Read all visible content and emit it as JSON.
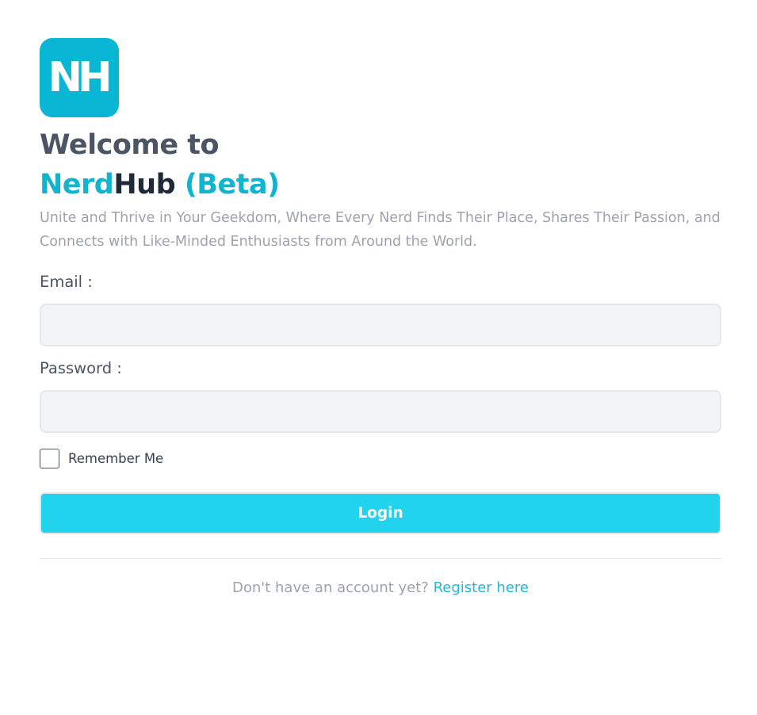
{
  "logo": {
    "text": "NH",
    "background": "#09b6d4"
  },
  "heading": {
    "welcome": "Welcome to",
    "brand_nerd": "Nerd",
    "brand_hub": "Hub",
    "brand_beta": "(Beta)"
  },
  "tagline": "Unite and Thrive in Your Geekdom, Where Every Nerd Finds Their Place, Shares Their Passion, and Connects with Like-Minded Enthusiasts from Around the World.",
  "form": {
    "email_label": "Email :",
    "email_value": "",
    "password_label": "Password :",
    "password_value": "",
    "remember_label": "Remember Me",
    "remember_checked": false,
    "login_label": "Login"
  },
  "footer": {
    "prompt": "Don't have an account yet? ",
    "register_link": "Register here"
  },
  "colors": {
    "accent": "#22d3ee",
    "brand": "#10b4cf",
    "text_dark": "#1f2937",
    "text_muted": "#9ca3af"
  }
}
